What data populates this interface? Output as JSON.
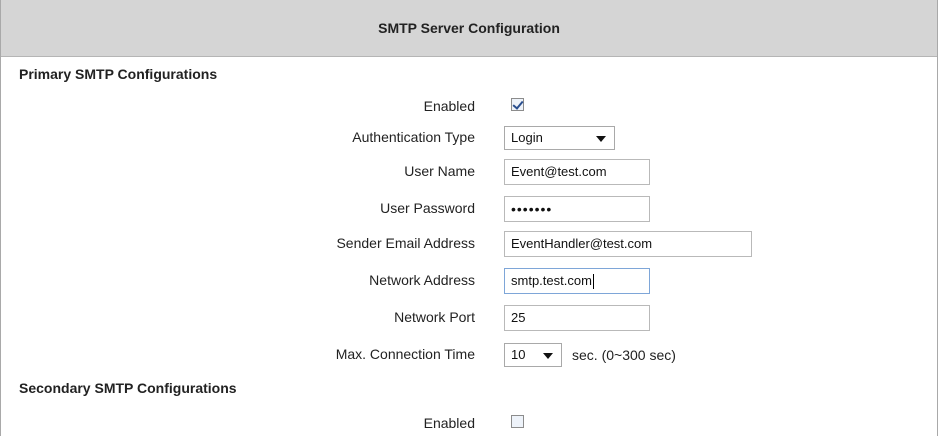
{
  "header": {
    "title": "SMTP Server Configuration"
  },
  "primary": {
    "title": "Primary SMTP Configurations",
    "enabled": {
      "label": "Enabled",
      "checked": true
    },
    "auth_type": {
      "label": "Authentication Type",
      "value": "Login"
    },
    "user_name": {
      "label": "User Name",
      "value": "Event@test.com"
    },
    "user_password": {
      "label": "User Password",
      "value": "•••••••"
    },
    "sender_email": {
      "label": "Sender Email Address",
      "value": "EventHandler@test.com"
    },
    "network_address": {
      "label": "Network Address",
      "value": "smtp.test.com"
    },
    "network_port": {
      "label": "Network Port",
      "value": "25"
    },
    "max_connection_time": {
      "label": "Max. Connection Time",
      "value": "10",
      "suffix": "sec. (0~300 sec)"
    }
  },
  "secondary": {
    "title": "Secondary SMTP Configurations",
    "enabled": {
      "label": "Enabled",
      "checked": false
    }
  }
}
